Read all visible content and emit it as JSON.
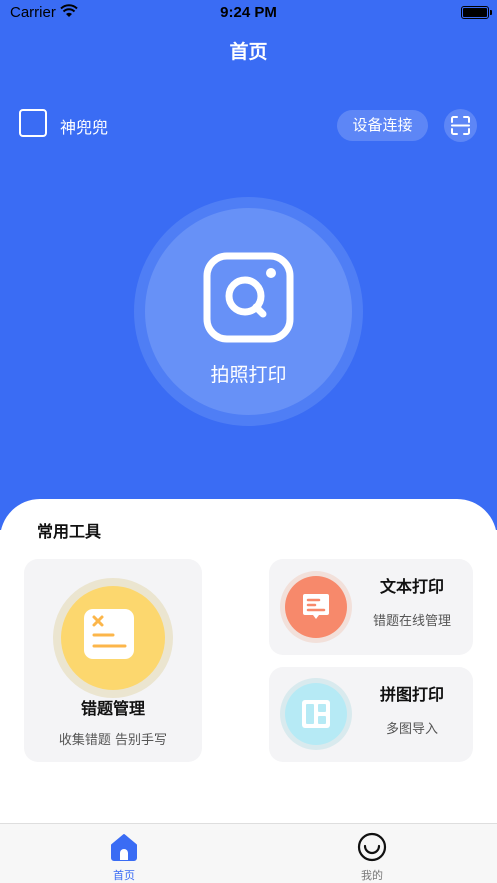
{
  "status_bar": {
    "carrier": "Carrier",
    "time": "9:24 PM"
  },
  "header": {
    "title": "首页"
  },
  "device": {
    "name": "神兜兜",
    "connect_label": "设备连接"
  },
  "camera": {
    "label": "拍照打印"
  },
  "tools": {
    "title": "常用工具",
    "items": [
      {
        "label": "错题管理",
        "subtitle": "收集错题 告别手写"
      },
      {
        "label": "文本打印",
        "subtitle": "错题在线管理"
      },
      {
        "label": "拼图打印",
        "subtitle": "多图导入"
      }
    ]
  },
  "tabbar": {
    "tabs": [
      {
        "label": "首页",
        "active": true,
        "icon": "home-icon"
      },
      {
        "label": "我的",
        "active": false,
        "icon": "smile-icon"
      }
    ]
  },
  "colors": {
    "primary": "#3a6cf4",
    "yellow": "#fcd76e",
    "coral": "#f7896b",
    "cyan": "#b6eaf5"
  }
}
